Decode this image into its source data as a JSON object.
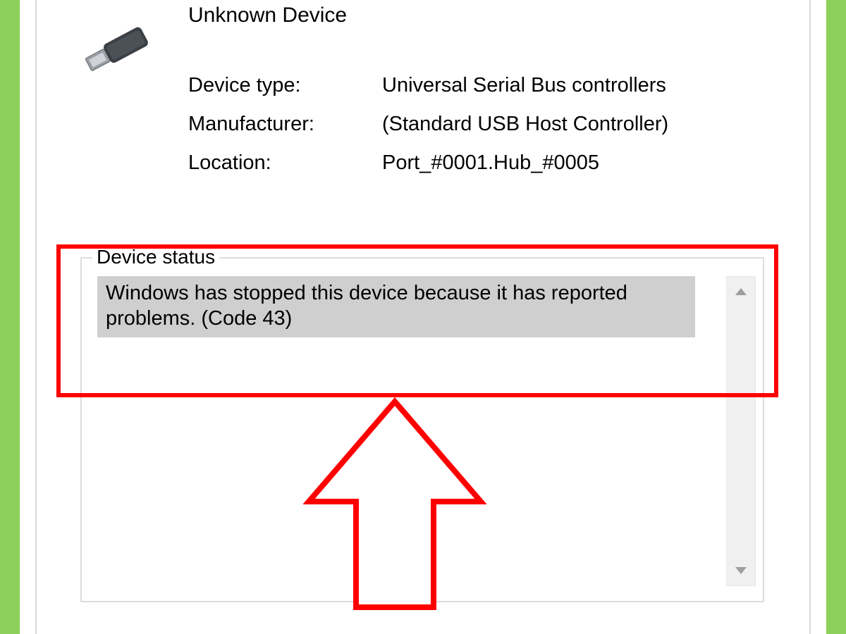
{
  "device": {
    "name": "Unknown Device",
    "labels": {
      "type": "Device type:",
      "manufacturer": "Manufacturer:",
      "location": "Location:"
    },
    "values": {
      "type": "Universal Serial Bus controllers",
      "manufacturer": "(Standard USB Host Controller)",
      "location": "Port_#0001.Hub_#0005"
    }
  },
  "status": {
    "legend": "Device status",
    "message": "Windows has stopped this device because it has reported problems. (Code 43)"
  }
}
